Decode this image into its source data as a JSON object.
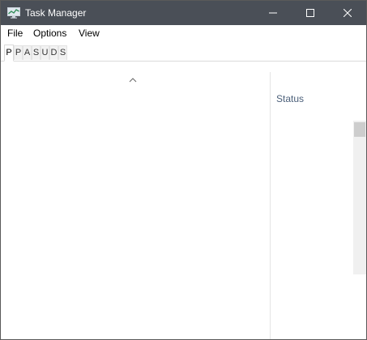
{
  "window": {
    "title": "Task Manager",
    "app_icon": "task-manager-icon"
  },
  "titlebar_buttons": {
    "minimize_icon": "minimize-icon",
    "maximize_icon": "maximize-icon",
    "close_icon": "close-icon"
  },
  "menu": {
    "file": "File",
    "options": "Options",
    "view": "View"
  },
  "tabs": [
    {
      "label": "P"
    },
    {
      "label": "P"
    },
    {
      "label": "A"
    },
    {
      "label": "S"
    },
    {
      "label": "U"
    },
    {
      "label": "D"
    },
    {
      "label": "S"
    }
  ],
  "table": {
    "sort_icon": "chevron-up-icon",
    "columns": {
      "status": "Status"
    }
  },
  "colors": {
    "titlebar": "#4a4f57",
    "column_header_text": "#4c607a"
  }
}
